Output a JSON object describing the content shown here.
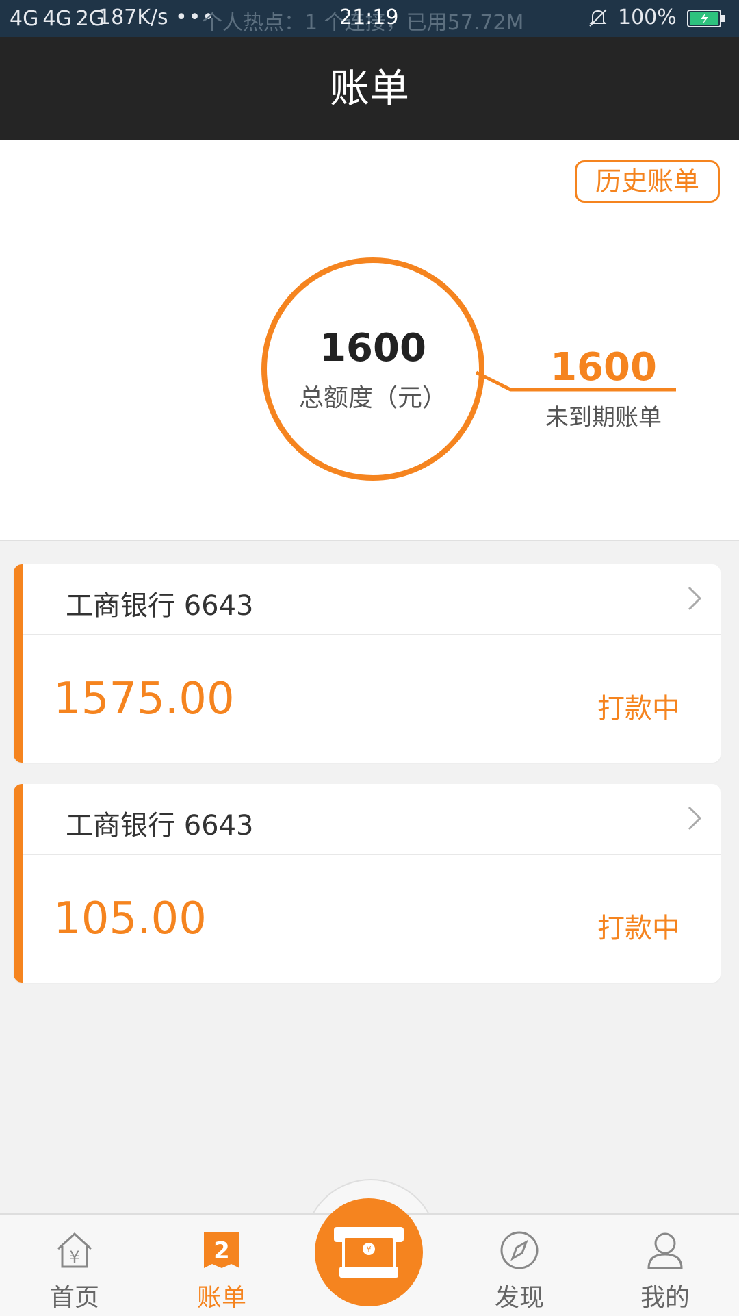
{
  "status_bar": {
    "net1": "4G",
    "net2": "4G",
    "net3": "2G",
    "speed": "187K/s",
    "more": "•••",
    "hotspot": "个人热点：1 个连接，已用57.72M",
    "time": "21:19",
    "battery": "100%"
  },
  "header": {
    "title": "账单"
  },
  "summary": {
    "history_label": "历史账单",
    "total_value": "1600",
    "total_label": "总额度（元）",
    "due_value": "1600",
    "due_label": "未到期账单"
  },
  "bills": [
    {
      "bank": "工商银行 6643",
      "amount": "1575.00",
      "status": "打款中"
    },
    {
      "bank": "工商银行 6643",
      "amount": "105.00",
      "status": "打款中"
    }
  ],
  "nav": {
    "home": "首页",
    "bills": "账单",
    "bills_badge": "2",
    "discover": "发现",
    "mine": "我的"
  },
  "colors": {
    "accent": "#f5841f",
    "header_bg": "#252525",
    "status_bg": "#1f3447"
  }
}
